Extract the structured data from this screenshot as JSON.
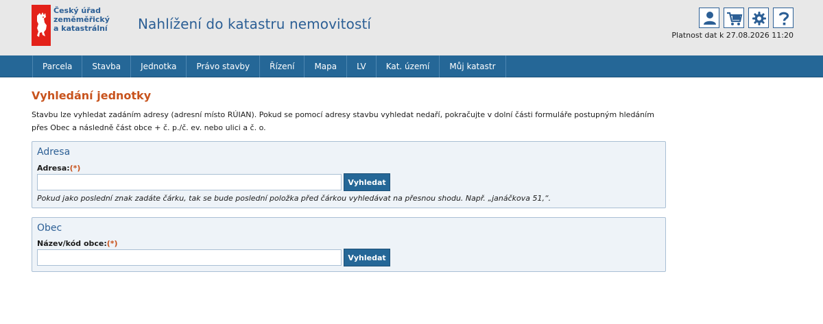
{
  "header": {
    "org_name_lines": [
      "Český úřad",
      "zeměměřický",
      "a katastrální"
    ],
    "app_title": "Nahlížení do katastru nemovitostí",
    "tools": [
      {
        "icon": "user-icon"
      },
      {
        "icon": "cart-icon"
      },
      {
        "icon": "gear-icon"
      },
      {
        "icon": "help-icon"
      }
    ],
    "validity": "Platnost dat k 27.08.2026 11:20"
  },
  "nav": {
    "items": [
      "Parcela",
      "Stavba",
      "Jednotka",
      "Právo stavby",
      "Řízení",
      "Mapa",
      "LV",
      "Kat. území",
      "Můj katastr"
    ]
  },
  "main": {
    "title": "Vyhledání jednotky",
    "intro_line1": "Stavbu lze vyhledat zadáním adresy (adresní místo RÚIAN). Pokud se pomocí adresy stavbu vyhledat nedaří, pokračujte v dolní části formuláře postupným hledáním",
    "intro_line2": "přes Obec a následně část obce + č. p./č. ev. nebo ulici a č. o.",
    "address_panel": {
      "title": "Adresa",
      "label": "Adresa:",
      "required_mark": "(*)",
      "value": "",
      "button": "Vyhledat",
      "hint": "Pokud jako poslední znak zadáte čárku, tak se bude poslední položka před čárkou vyhledávat na přesnou shodu. Např. „janáčkova 51,“."
    },
    "municipality_panel": {
      "title": "Obec",
      "label": "Název/kód obce:",
      "required_mark": "(*)",
      "value": "",
      "button": "Vyhledat"
    }
  },
  "colors": {
    "brand_blue": "#2c5f95",
    "nav_blue": "#256797",
    "accent_orange": "#c8531d",
    "logo_red": "#e32119",
    "panel_bg": "#eef3f8"
  }
}
